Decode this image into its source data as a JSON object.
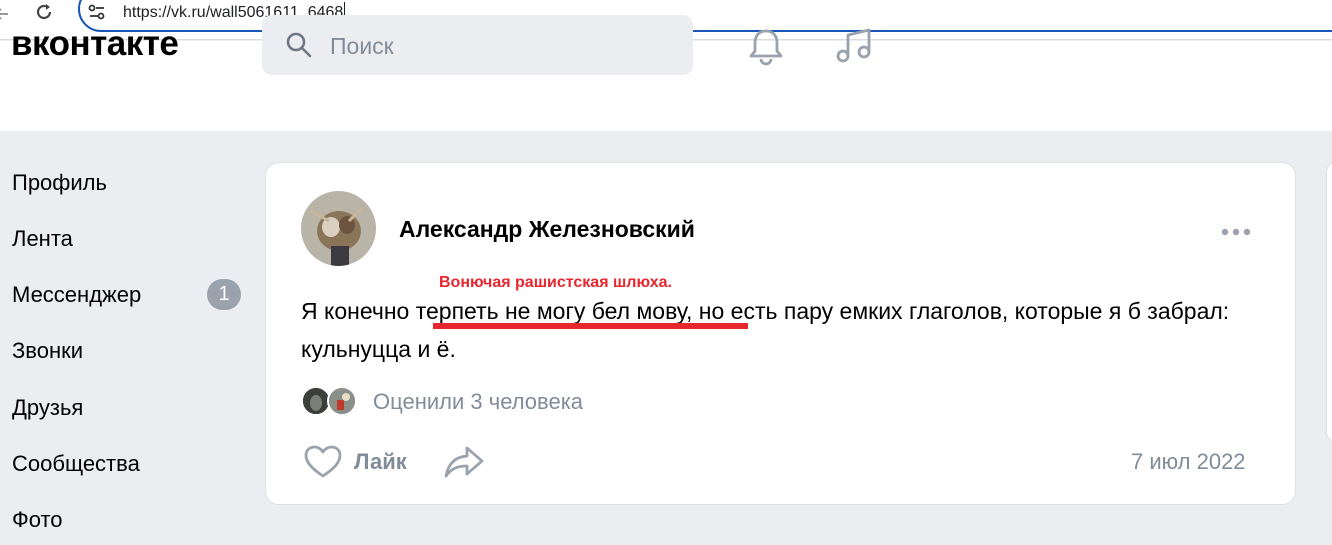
{
  "browser": {
    "url": "https://vk.ru/wall5061611_6468",
    "icons": [
      "back-arrow-icon",
      "reload-icon",
      "site-info-icon"
    ]
  },
  "header": {
    "logo": "вконтакте",
    "search_placeholder": "Поиск",
    "icons": [
      "search-icon",
      "bell-icon",
      "music-icon"
    ]
  },
  "sidebar": {
    "items": [
      {
        "label": "Профиль"
      },
      {
        "label": "Лента"
      },
      {
        "label": "Мессенджер",
        "badge": "1"
      },
      {
        "label": "Звонки"
      },
      {
        "label": "Друзья"
      },
      {
        "label": "Сообщества"
      },
      {
        "label": "Фото"
      }
    ]
  },
  "post": {
    "author": "Александр Железновский",
    "annotation": "Вонючая рашистская шлюха.",
    "text_before": "Я конечно ",
    "text_highlight": "терпеть не могу бел мову",
    "text_after": ", но есть пару емких глаголов, которые я б забрал: кульнуцца и ё.",
    "likes_text": "Оценили 3 человека",
    "like_label": "Лайк",
    "date": "7 июл 2022"
  },
  "colors": {
    "accent_annotation": "#e8262e",
    "muted_text": "#818c99",
    "page_bg": "#ebedf0",
    "address_border": "#1a56b8"
  }
}
